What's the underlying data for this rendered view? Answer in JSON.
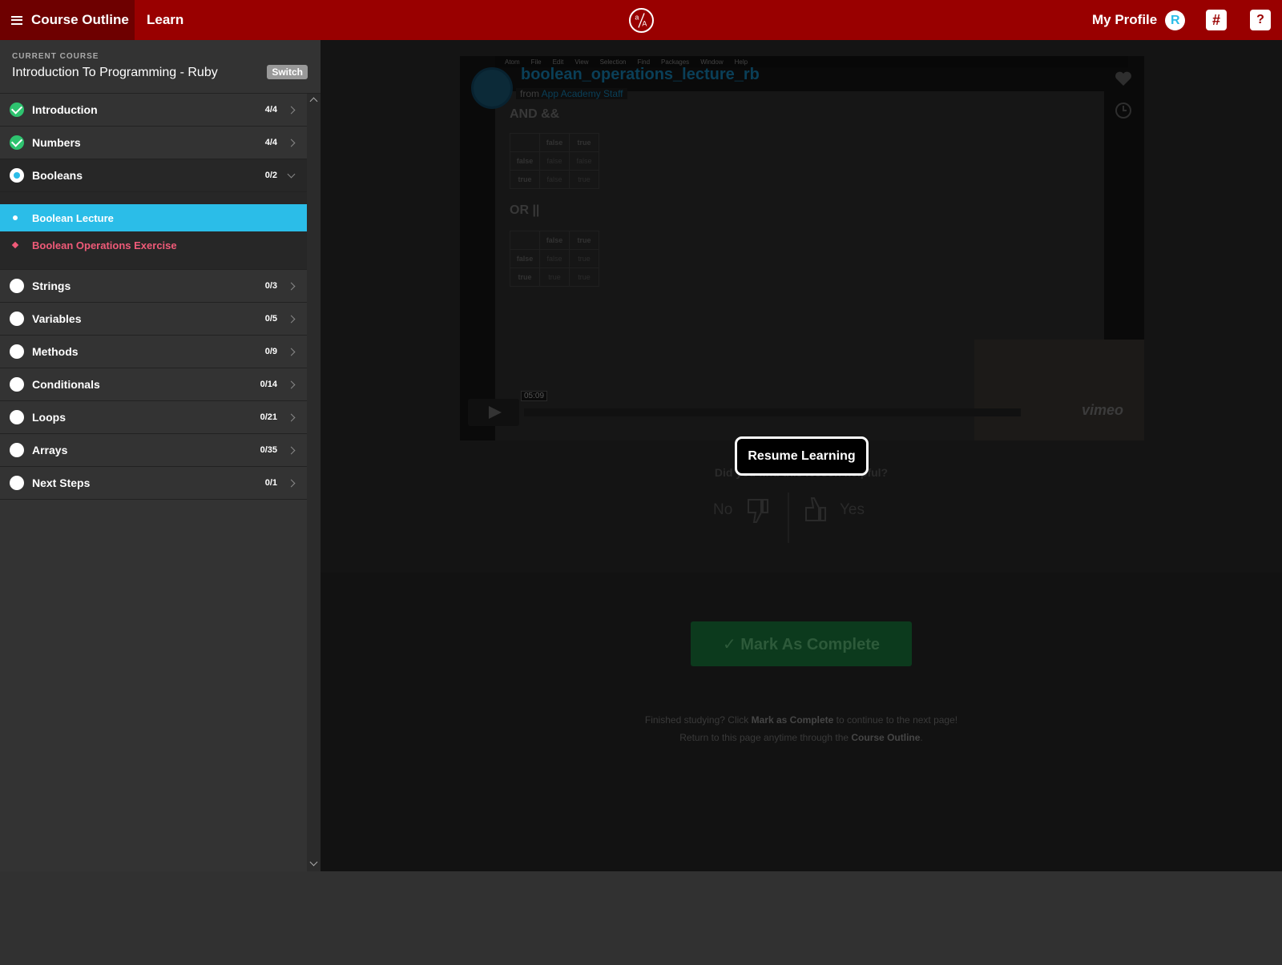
{
  "topbar": {
    "course_outline": "Course Outline",
    "learn": "Learn",
    "profile": "My Profile",
    "avatar_letter": "R",
    "help": "?",
    "slack_icon": "slack-icon",
    "logo_icon": "app-academy-logo"
  },
  "course": {
    "label": "CURRENT COURSE",
    "title": "Introduction To Programming - Ruby",
    "switch": "Switch"
  },
  "modules": [
    {
      "label": "Introduction",
      "count": "4/4",
      "state": "done"
    },
    {
      "label": "Numbers",
      "count": "4/4",
      "state": "done"
    },
    {
      "label": "Booleans",
      "count": "0/2",
      "state": "current"
    },
    {
      "label": "Strings",
      "count": "0/3",
      "state": "todo"
    },
    {
      "label": "Variables",
      "count": "0/5",
      "state": "todo"
    },
    {
      "label": "Methods",
      "count": "0/9",
      "state": "todo"
    },
    {
      "label": "Conditionals",
      "count": "0/14",
      "state": "todo"
    },
    {
      "label": "Loops",
      "count": "0/21",
      "state": "todo"
    },
    {
      "label": "Arrays",
      "count": "0/35",
      "state": "todo"
    },
    {
      "label": "Next Steps",
      "count": "0/1",
      "state": "todo"
    }
  ],
  "lessons": [
    {
      "label": "Boolean Lecture",
      "active": true
    },
    {
      "label": "Boolean Operations Exercise",
      "active": false
    }
  ],
  "video": {
    "title": "boolean_operations_lecture_rb",
    "from": "from",
    "author": "App Academy Staff",
    "menubar": [
      "Atom",
      "File",
      "Edit",
      "View",
      "Selection",
      "Find",
      "Packages",
      "Window",
      "Help"
    ],
    "and_heading": "AND &&",
    "or_heading": "OR ||",
    "and_table": [
      [
        "",
        "false",
        "true"
      ],
      [
        "false",
        "false",
        "false"
      ],
      [
        "true",
        "false",
        "true"
      ]
    ],
    "or_table": [
      [
        "",
        "false",
        "true"
      ],
      [
        "false",
        "false",
        "true"
      ],
      [
        "true",
        "true",
        "true"
      ]
    ],
    "time": "05:09",
    "brand": "vimeo"
  },
  "resume": "Resume Learning",
  "feedback": {
    "question": "Did you find this lesson helpful?",
    "no": "No",
    "yes": "Yes"
  },
  "complete": {
    "button": "✓ Mark As Complete",
    "line1_pre": "Finished studying? Click ",
    "line1_bold": "Mark as Complete",
    "line1_post": " to continue to the next page!",
    "line2_pre": "Return to this page anytime through the ",
    "line2_bold": "Course Outline",
    "line2_post": "."
  },
  "colors": {
    "brand_red": "#990000",
    "accent_blue": "#2bbde8",
    "done_green": "#2ec36f",
    "exercise_pink": "#f05a78"
  }
}
